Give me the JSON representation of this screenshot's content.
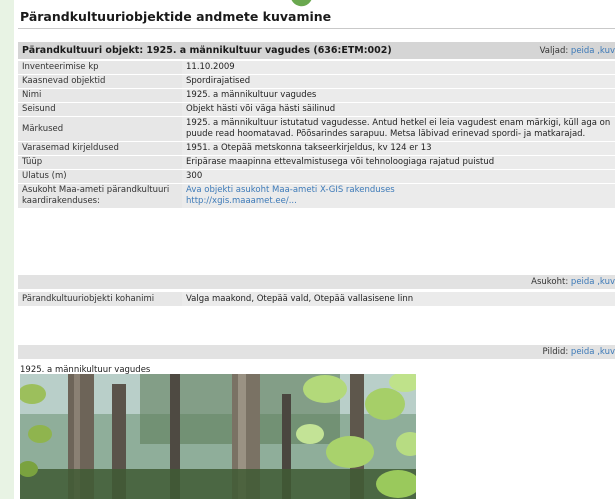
{
  "page": {
    "title": "Pärandkultuuriobjektide andmete kuvamine"
  },
  "object_header": {
    "title": "Pärandkultuuri objekt: 1925. a männikultuur vagudes (636:ETM:002)",
    "toggle_label": "Valjad:",
    "hide_link": "peida",
    "show_link": ",kuv"
  },
  "fields": [
    {
      "label": "Inventeerimise kp",
      "value": "11.10.2009"
    },
    {
      "label": "Kaasnevad objektid",
      "value": "Spordirajatised"
    },
    {
      "label": "Nimi",
      "value": "1925. a männikultuur vagudes"
    },
    {
      "label": "Seisund",
      "value": "Objekt hästi või väga hästi säilinud"
    },
    {
      "label": "Märkused",
      "value": "1925. a männikultuur istutatud vagudesse. Antud hetkel ei leia vagudest enam märkigi, küll aga on puude read hoomatavad. Põõsarindes sarapuu. Metsa läbivad erinevad spordi- ja matkarajad."
    },
    {
      "label": "Varasemad kirjeldused",
      "value": "1951. a Otepää metskonna takseerkirjeldus, kv 124 er 13"
    },
    {
      "label": "Tüüp",
      "value": "Eripärase maapinna ettevalmistusega või tehnoloogiaga rajatud puistud"
    },
    {
      "label": "Ulatus (m)",
      "value": "300"
    },
    {
      "label": "Asukoht Maa-ameti pärandkultuuri kaardirakenduses:",
      "link1": "Ava objekti asukoht Maa-ameti X-GIS rakenduses",
      "link2": "http://xgis.maaamet.ee/..."
    }
  ],
  "location_section": {
    "label": "Asukoht:",
    "hide_link": "peida",
    "show_link": ",kuv"
  },
  "location_row": {
    "label": "Pärandkultuuriobjekti kohanimi",
    "value": "Valga maakond, Otepää vald, Otepää vallasisene linn"
  },
  "images_section": {
    "label": "Pildid:",
    "hide_link": "peida",
    "show_link": ",kuv"
  },
  "photo": {
    "caption": "1925. a männikultuur vagudes"
  }
}
